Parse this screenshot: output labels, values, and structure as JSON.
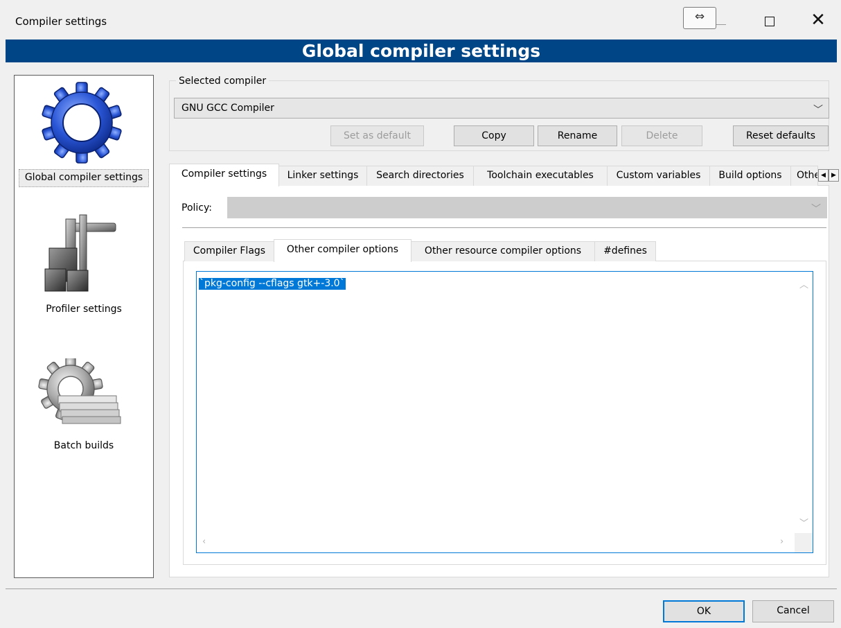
{
  "window": {
    "title": "Compiler settings",
    "snap_glyph": "⇔",
    "close_glyph": "✕"
  },
  "header": {
    "title": "Global compiler settings"
  },
  "left_panel": {
    "items": [
      {
        "label": "Global compiler settings",
        "icon": "gear-icon",
        "selected": true
      },
      {
        "label": "Profiler settings",
        "icon": "caliper-icon",
        "selected": false
      },
      {
        "label": "Batch builds",
        "icon": "batch-gear-icon",
        "selected": false
      }
    ]
  },
  "compiler_group": {
    "label": "Selected compiler",
    "selected": "GNU GCC Compiler",
    "buttons": {
      "set_default": "Set as default",
      "copy": "Copy",
      "rename": "Rename",
      "delete": "Delete",
      "reset": "Reset defaults"
    }
  },
  "main_tabs": [
    "Compiler settings",
    "Linker settings",
    "Search directories",
    "Toolchain executables",
    "Custom variables",
    "Build options",
    "Other settings"
  ],
  "policy": {
    "label": "Policy:",
    "value": ""
  },
  "sub_tabs": [
    "Compiler Flags",
    "Other compiler options",
    "Other resource compiler options",
    "#defines"
  ],
  "editor": {
    "text": "`pkg-config --cflags gtk+-3.0`"
  },
  "footer": {
    "ok": "OK",
    "cancel": "Cancel"
  },
  "colors": {
    "banner": "#004586",
    "accent": "#0078d7",
    "gear_blue": "#2a56d6"
  }
}
